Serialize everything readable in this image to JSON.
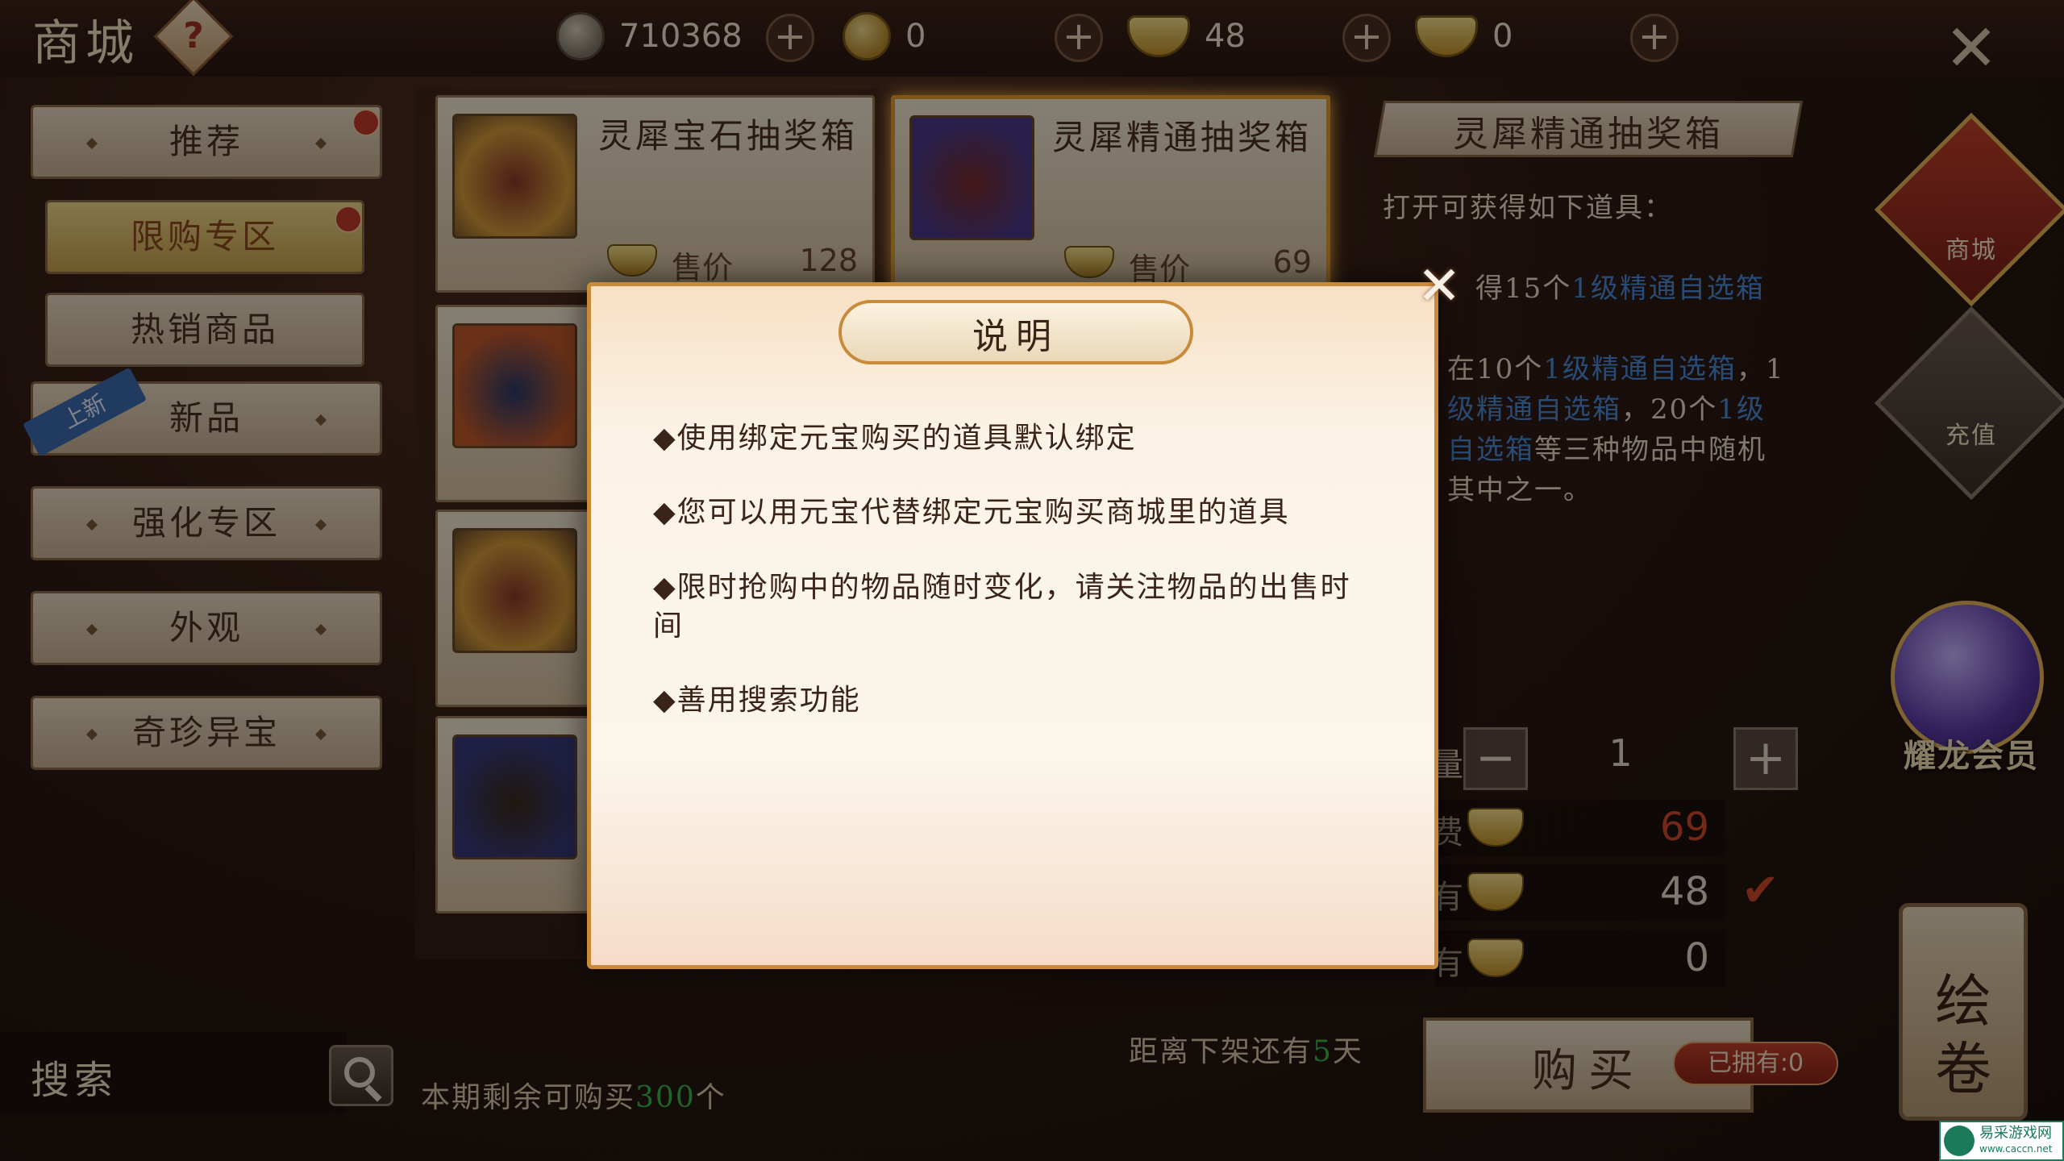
{
  "header": {
    "title": "商城",
    "help_icon": "question-mark-icon",
    "currencies": [
      {
        "icon": "silver-coin-icon",
        "value": "710368"
      },
      {
        "icon": "gold-coin-icon",
        "value": "0"
      },
      {
        "icon": "bound-ingot-icon",
        "value": "48"
      },
      {
        "icon": "gold-ingot-icon",
        "value": "0"
      }
    ],
    "plus_label": "+"
  },
  "sidebar": {
    "items": [
      {
        "label": "推荐"
      },
      {
        "label": "限购专区"
      },
      {
        "label": "热销商品"
      },
      {
        "label": "新品",
        "ribbon": "上新"
      },
      {
        "label": "强化专区"
      },
      {
        "label": "外观"
      },
      {
        "label": "奇珍异宝"
      }
    ]
  },
  "products": [
    {
      "name": "灵犀宝石抽奖箱",
      "price_label": "售价",
      "price": "128"
    },
    {
      "name": "灵犀精通抽奖箱",
      "price_label": "售价",
      "price": "69"
    }
  ],
  "detail": {
    "title": "灵犀精通抽奖箱",
    "subtitle": "打开可获得如下道具：",
    "line1_a": "得15个",
    "line1_b": "1级精通自选箱",
    "line2_a": "在10个",
    "line2_b": "1级精通自选箱",
    "line2_c": "，1",
    "line3_a": "级精通自选箱",
    "line3_b": "，20个",
    "line3_c": "1级",
    "line4_a": "自选箱",
    "line4_b": "等三种物品中随机",
    "line5": "其中之一。",
    "qty_minus": "−",
    "qty_value": "1",
    "qty_plus": "+",
    "qty_label_tail": "量",
    "cost_label_tail": "费",
    "own1_label_tail": "有",
    "own2_label_tail": "有",
    "cost_value": "69",
    "own_bound_value": "48",
    "own_gold_value": "0",
    "check_mark": "✔"
  },
  "side_buttons": {
    "shop": "商城",
    "recharge": "充值",
    "vip": "耀龙会员",
    "scroll": "绘卷"
  },
  "footer": {
    "search_label": "搜索",
    "remain_prefix": "本期剩余可购买",
    "remain_count": "300",
    "remain_suffix": "个",
    "timer_prefix": "距离下架还有",
    "timer_value": "5",
    "timer_suffix": "天",
    "buy_label": "购买",
    "owned_label": "已拥有:0"
  },
  "dialog": {
    "title": "说明",
    "lines": [
      "◆使用绑定元宝购买的道具默认绑定",
      "◆您可以用元宝代替绑定元宝购买商城里的道具",
      "◆限时抢购中的物品随时变化，请关注物品的出售时间",
      "◆善用搜索功能"
    ],
    "close_icon": "close-icon"
  },
  "watermark": {
    "text": "易采游戏网",
    "url": "www.caccn.net"
  },
  "colors": {
    "accent_gold": "#e39b2a",
    "price_red": "#d24a2a",
    "highlight_blue": "#4a8ad8",
    "highlight_green": "#3ab84a"
  }
}
